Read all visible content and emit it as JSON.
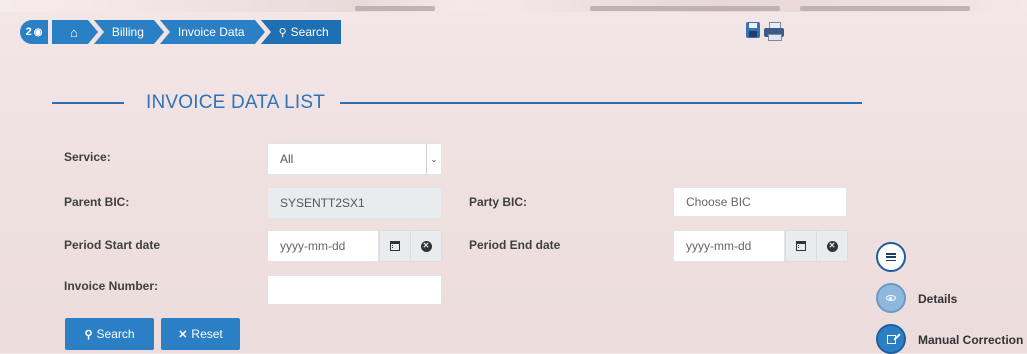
{
  "breadcrumb": {
    "badge_count": "2",
    "items": [
      {
        "label": ""
      },
      {
        "label": "Billing"
      },
      {
        "label": "Invoice Data"
      },
      {
        "label": "Search"
      }
    ]
  },
  "page": {
    "title": "INVOICE DATA LIST"
  },
  "form": {
    "service": {
      "label": "Service:",
      "value": "All"
    },
    "parent_bic": {
      "label": "Parent BIC:",
      "value": "SYSENTT2SX1"
    },
    "party_bic": {
      "label": "Party BIC:",
      "placeholder": "Choose BIC"
    },
    "period_start": {
      "label": "Period Start date",
      "placeholder": "yyyy-mm-dd"
    },
    "period_end": {
      "label": "Period End date",
      "placeholder": "yyyy-mm-dd"
    },
    "invoice_number": {
      "label": "Invoice Number:",
      "value": ""
    }
  },
  "buttons": {
    "search": "Search",
    "reset": "Reset"
  },
  "side_actions": {
    "details": "Details",
    "manual_correction": "Manual Correction"
  },
  "colors": {
    "accent": "#2b7fc4",
    "background": "#f0e2e2"
  }
}
